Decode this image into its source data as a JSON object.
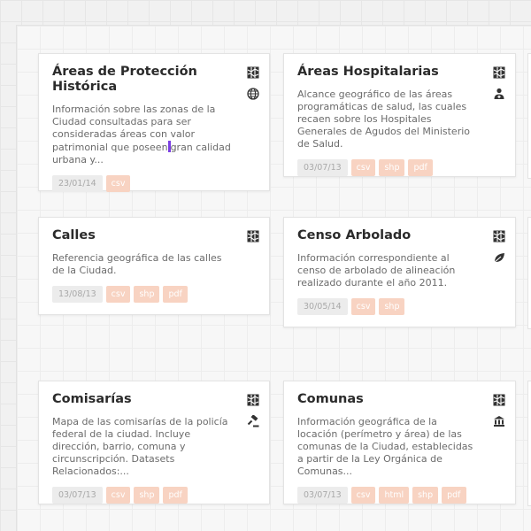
{
  "cards": [
    {
      "title": "Áreas de Protección Histórica",
      "description_before_caret": "Información sobre las zonas de la Ciudad consultadas para ser consideradas áreas con valor patrimonial que poseen",
      "description_after_caret": "gran calidad urbana y...",
      "date": "23/01/14",
      "formats": [
        "csv"
      ],
      "category_icon": "globe-icon"
    },
    {
      "title": "Áreas Hospitalarias",
      "description": "Alcance geográfico de las áreas programáticas de salud, las cuales recaen sobre los Hospitales Generales de Agudos del Ministerio de Salud.",
      "date": "03/07/13",
      "formats": [
        "csv",
        "shp",
        "pdf"
      ],
      "category_icon": "health-icon"
    },
    {
      "title": "Calles",
      "description": "Referencia geográfica de las calles de la Ciudad.",
      "date": "13/08/13",
      "formats": [
        "csv",
        "shp",
        "pdf"
      ]
    },
    {
      "title": "Censo Arbolado",
      "description": "Información correspondiente al censo de arbolado de alineación realizado durante el año 2011.",
      "date": "30/05/14",
      "formats": [
        "csv",
        "shp"
      ],
      "category_icon": "leaf-icon"
    },
    {
      "title": "Comisarías",
      "description": "Mapa de las comisarías de la policía federal de la ciudad. Incluye dirección, barrio, comuna y circunscripción. Datasets Relacionados:...",
      "date": "03/07/13",
      "formats": [
        "csv",
        "shp",
        "pdf"
      ],
      "category_icon": "gavel-icon"
    },
    {
      "title": "Comunas",
      "description": "Información geográfica de la locación (perímetro y área) de las comunas de la Ciudad, establecidas a partir de la Ley Orgánica de Comunas...",
      "date": "03/07/13",
      "formats": [
        "csv",
        "html",
        "shp",
        "pdf"
      ],
      "category_icon": "government-icon"
    }
  ],
  "colors": {
    "tag_format_bg": "#f8d3c2",
    "tag_date_bg": "#ececec",
    "caret": "#7b3fe4"
  }
}
